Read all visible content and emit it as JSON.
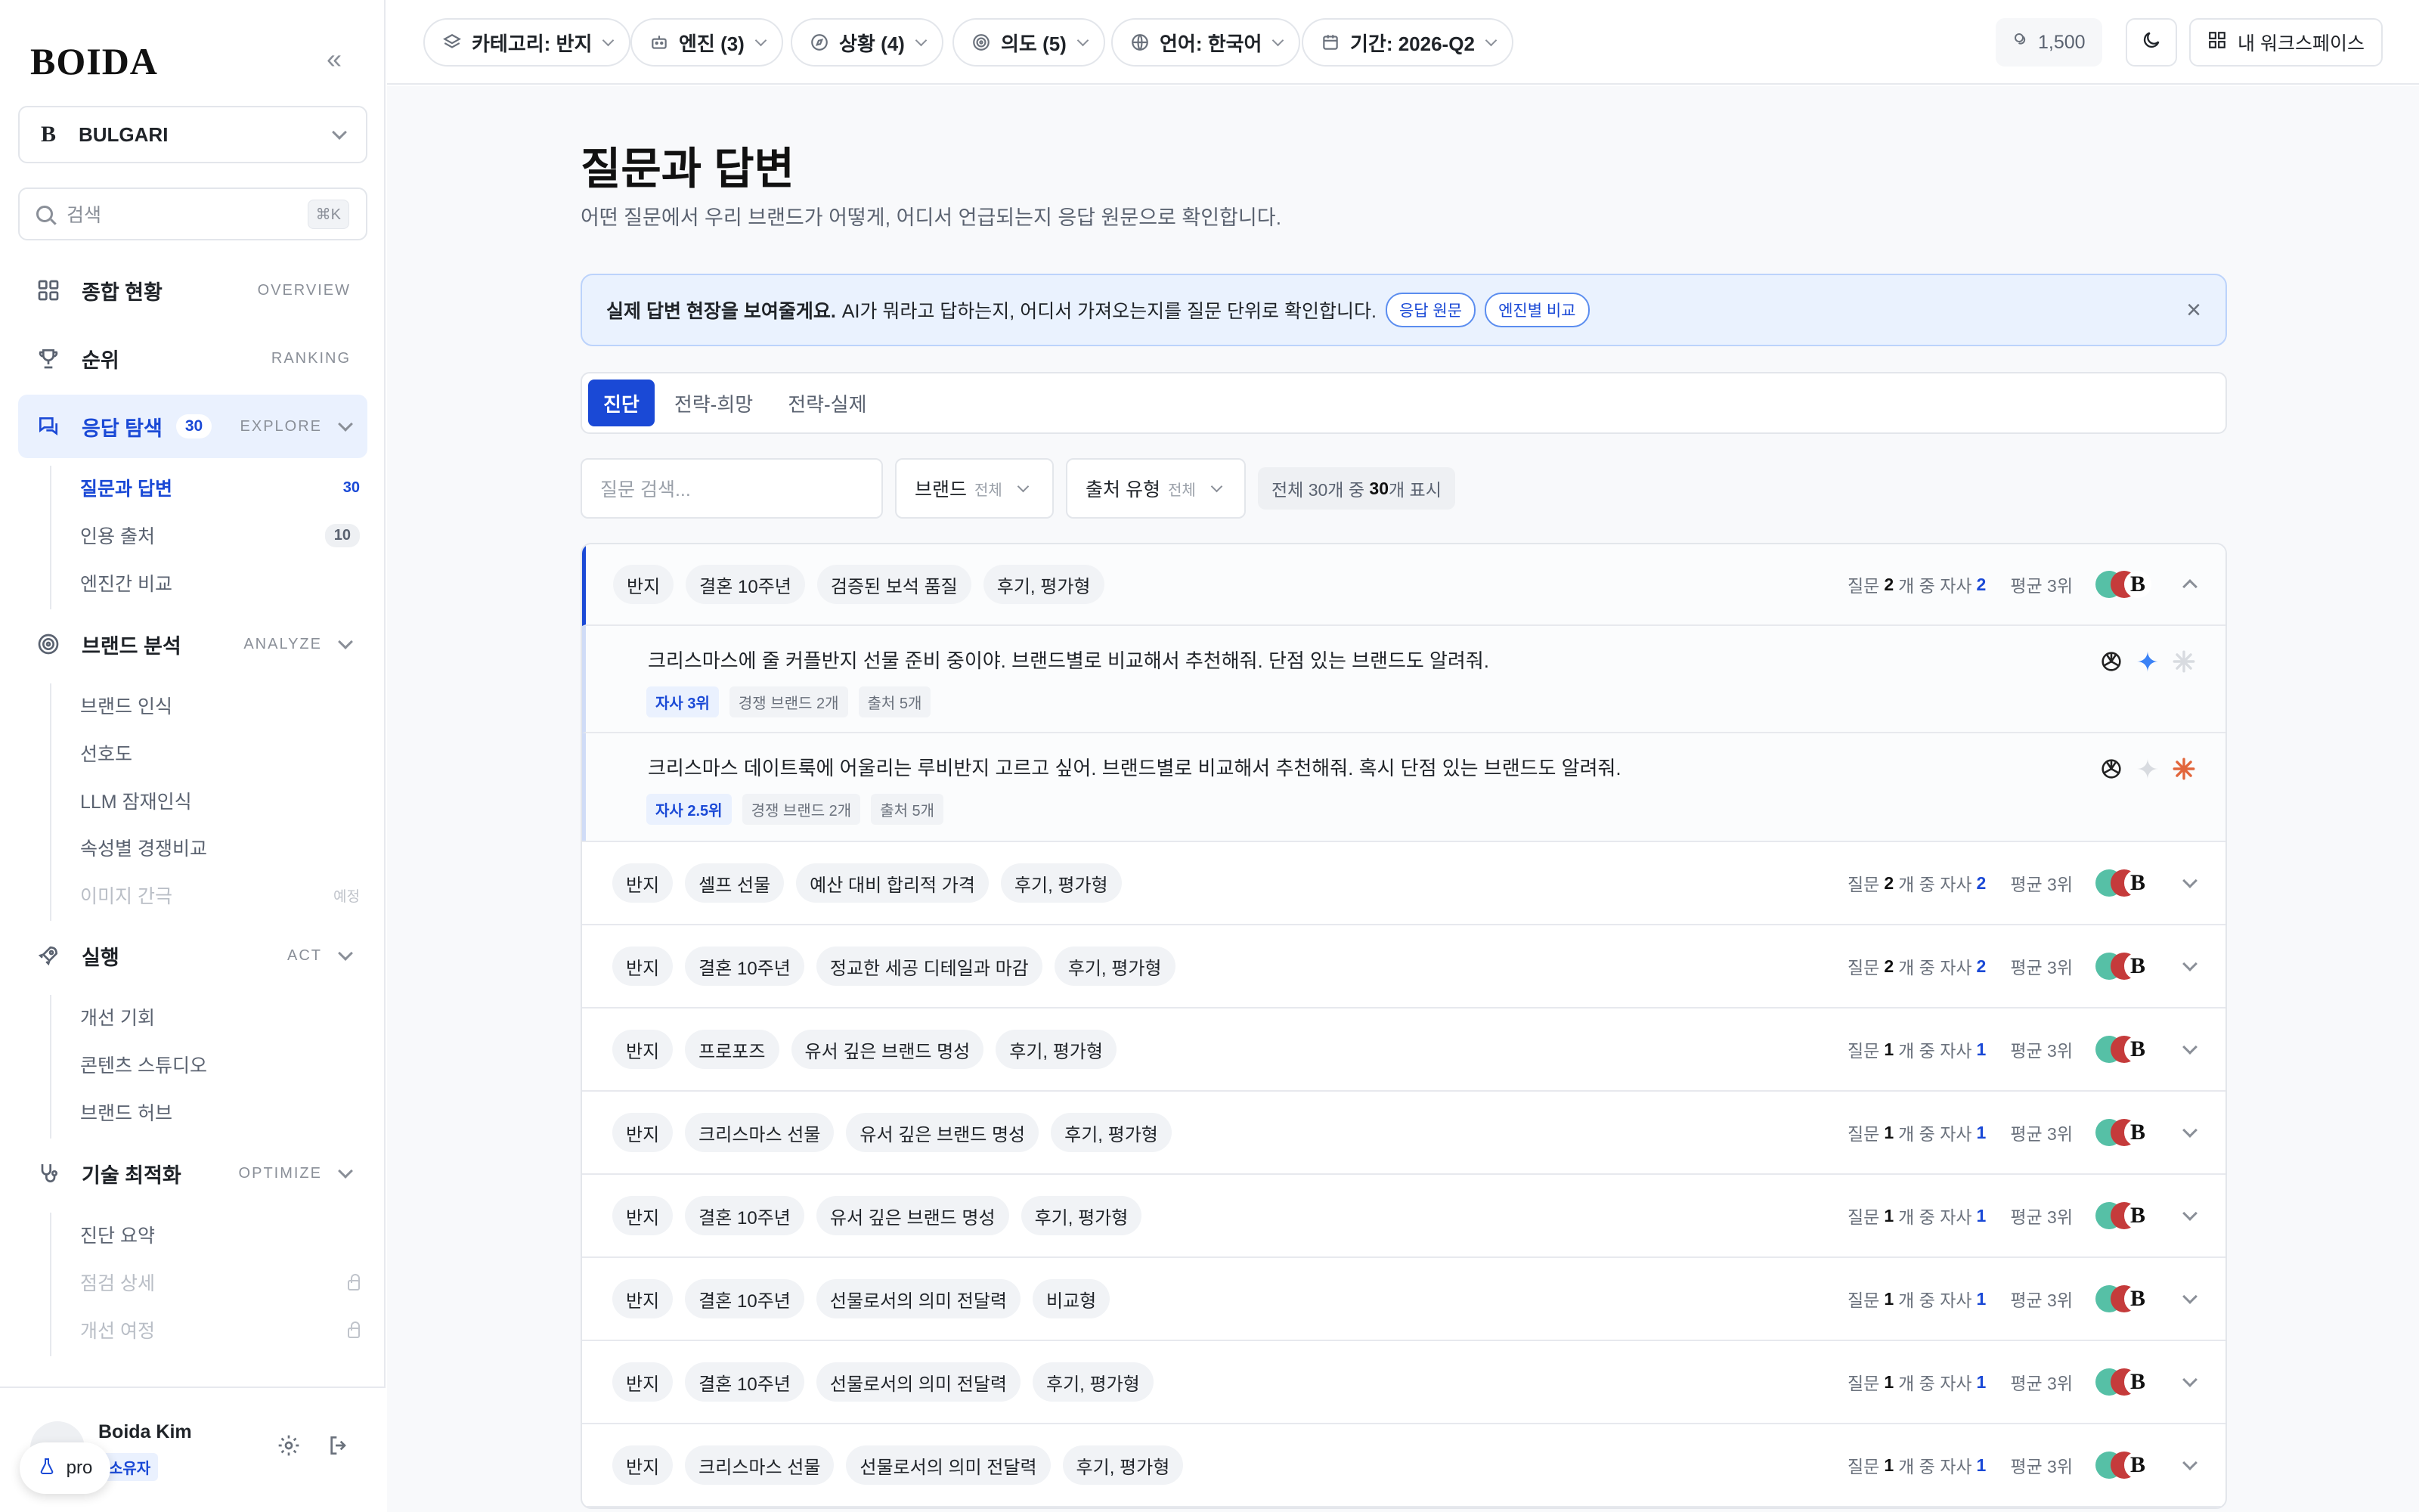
{
  "sidebar": {
    "logo": "BOIDA",
    "collapse_glyph": "«",
    "brand": {
      "mark": "B",
      "name": "BULGARI"
    },
    "search": {
      "placeholder": "검색",
      "shortcut": "⌘K"
    },
    "nav": [
      {
        "label": "종합 현황",
        "section": "OVERVIEW",
        "icon": "grid-icon"
      },
      {
        "label": "순위",
        "section": "RANKING",
        "icon": "trophy-icon"
      },
      {
        "label": "응답 탐색",
        "count": "30",
        "section": "EXPLORE",
        "icon": "chat-icon",
        "active": true,
        "items": [
          {
            "label": "질문과 답변",
            "count": "30",
            "active": true
          },
          {
            "label": "인용 출처",
            "count": "10"
          },
          {
            "label": "엔진간 비교"
          }
        ]
      },
      {
        "label": "브랜드 분석",
        "section": "ANALYZE",
        "icon": "target-icon",
        "items": [
          {
            "label": "브랜드 인식"
          },
          {
            "label": "선호도"
          },
          {
            "label": "LLM 잠재인식"
          },
          {
            "label": "속성별 경쟁비교"
          },
          {
            "label": "이미지 간극",
            "tag": "예정",
            "disabled": true
          }
        ]
      },
      {
        "label": "실행",
        "section": "ACT",
        "icon": "rocket-icon",
        "items": [
          {
            "label": "개선 기회"
          },
          {
            "label": "콘텐츠 스튜디오"
          },
          {
            "label": "브랜드 허브"
          }
        ]
      },
      {
        "label": "기술 최적화",
        "section": "OPTIMIZE",
        "icon": "stethoscope-icon",
        "items": [
          {
            "label": "진단 요약"
          },
          {
            "label": "점검 상세",
            "locked": true
          },
          {
            "label": "개선 여정",
            "locked": true
          }
        ]
      }
    ],
    "footer": {
      "user_name": "Boida Kim",
      "role": "소유자",
      "plan": "pro"
    }
  },
  "topbar": {
    "filters": [
      {
        "label": "카테고리: 반지",
        "icon": "layers-icon"
      },
      {
        "label": "엔진 (3)",
        "icon": "bot-icon"
      },
      {
        "label": "상황 (4)",
        "icon": "compass-icon"
      },
      {
        "label": "의도 (5)",
        "icon": "target-icon"
      },
      {
        "label": "언어: 한국어",
        "icon": "globe-icon"
      },
      {
        "label": "기간: 2026-Q2",
        "icon": "calendar-icon"
      }
    ],
    "credits": "1,500",
    "workspace_label": "내 워크스페이스"
  },
  "main": {
    "title": "질문과 답변",
    "subtitle": "어떤 질문에서 우리 브랜드가 어떻게, 어디서 언급되는지 응답 원문으로 확인합니다.",
    "banner": {
      "strong": "실제 답변 현장을 보여줄게요.",
      "text": "AI가 뭐라고 답하는지, 어디서 가져오는지를 질문 단위로 확인합니다.",
      "tag1": "응답 원문",
      "tag2": "엔진별 비교",
      "close": "×"
    },
    "tabs": [
      "진단",
      "전략-희망",
      "전략-실제"
    ],
    "filters": {
      "search_placeholder": "질문 검색...",
      "brand_label": "브랜드",
      "brand_value": "전체",
      "source_label": "출처 유형",
      "source_value": "전체",
      "count_prefix": "전체 30개 중",
      "count_shown": "30",
      "count_suffix": "개 표시"
    },
    "groups": [
      {
        "chips": [
          "반지",
          "결혼 10주년",
          "검증된 보석 품질",
          "후기, 평가형"
        ],
        "q_count": "2",
        "self_count": "2",
        "avg": "평균 3위",
        "open": true,
        "questions": [
          {
            "text": "크리스마스에 줄 커플반지 선물 준비 중이야. 브랜드별로 비교해서 추천해줘. 단점 있는 브랜드도 알려줘.",
            "rank": "자사 3위",
            "competitors": "경쟁 브랜드 2개",
            "sources": "출처 5개"
          },
          {
            "text": "크리스마스 데이트룩에 어울리는 루비반지 고르고 싶어. 브랜드별로 비교해서 추천해줘. 혹시 단점 있는 브랜드도 알려줘.",
            "rank": "자사 2.5위",
            "competitors": "경쟁 브랜드 2개",
            "sources": "출처 5개"
          }
        ]
      },
      {
        "chips": [
          "반지",
          "셀프 선물",
          "예산 대비 합리적 가격",
          "후기, 평가형"
        ],
        "q_count": "2",
        "self_count": "2",
        "avg": "평균 3위"
      },
      {
        "chips": [
          "반지",
          "결혼 10주년",
          "정교한 세공 디테일과 마감",
          "후기, 평가형"
        ],
        "q_count": "2",
        "self_count": "2",
        "avg": "평균 3위"
      },
      {
        "chips": [
          "반지",
          "프로포즈",
          "유서 깊은 브랜드 명성",
          "후기, 평가형"
        ],
        "q_count": "1",
        "self_count": "1",
        "avg": "평균 3위"
      },
      {
        "chips": [
          "반지",
          "크리스마스 선물",
          "유서 깊은 브랜드 명성",
          "후기, 평가형"
        ],
        "q_count": "1",
        "self_count": "1",
        "avg": "평균 3위"
      },
      {
        "chips": [
          "반지",
          "결혼 10주년",
          "유서 깊은 브랜드 명성",
          "후기, 평가형"
        ],
        "q_count": "1",
        "self_count": "1",
        "avg": "평균 3위"
      },
      {
        "chips": [
          "반지",
          "결혼 10주년",
          "선물로서의 의미 전달력",
          "비교형"
        ],
        "q_count": "1",
        "self_count": "1",
        "avg": "평균 3위"
      },
      {
        "chips": [
          "반지",
          "결혼 10주년",
          "선물로서의 의미 전달력",
          "후기, 평가형"
        ],
        "q_count": "1",
        "self_count": "1",
        "avg": "평균 3위"
      },
      {
        "chips": [
          "반지",
          "크리스마스 선물",
          "선물로서의 의미 전달력",
          "후기, 평가형"
        ],
        "q_count": "1",
        "self_count": "1",
        "avg": "평균 3위"
      }
    ],
    "meta_labels": {
      "q_prefix": "질문",
      "q_mid": "개 중 자사"
    },
    "brand_mark": "B"
  },
  "colors": {
    "accent": "#1a49d6",
    "engine_green": "#56c0a6",
    "engine_red": "#c53b3b"
  }
}
